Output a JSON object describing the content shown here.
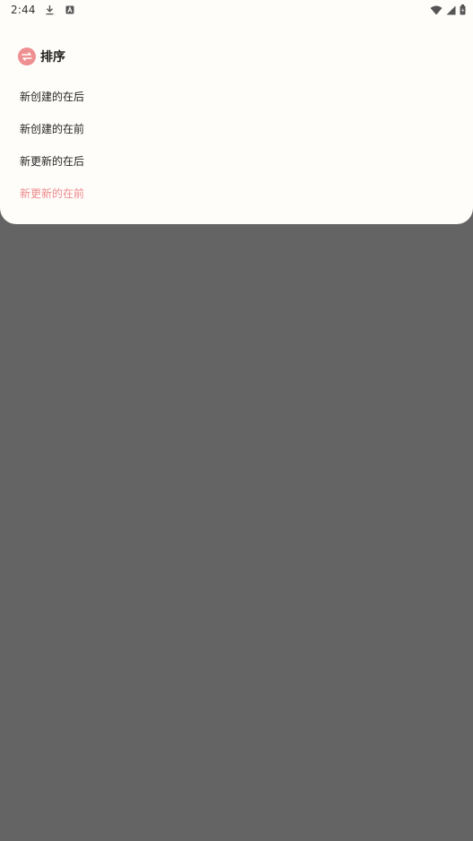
{
  "status_bar": {
    "time": "2:44",
    "left_icons": [
      "download-icon",
      "a-badge-icon"
    ],
    "right_icons": [
      "wifi-icon",
      "cellular-signal-icon",
      "battery-icon"
    ]
  },
  "sort_sheet": {
    "title": "排序",
    "icon": "sort-icon",
    "accent_color": "#ee8f91",
    "options": [
      {
        "label": "新创建的在后",
        "selected": false
      },
      {
        "label": "新创建的在前",
        "selected": false
      },
      {
        "label": "新更新的在后",
        "selected": false
      },
      {
        "label": "新更新的在前",
        "selected": true
      }
    ]
  },
  "colors": {
    "sheet_background": "#fffdfa",
    "scrim": "#646464",
    "selected_text": "#ec8a8c"
  }
}
